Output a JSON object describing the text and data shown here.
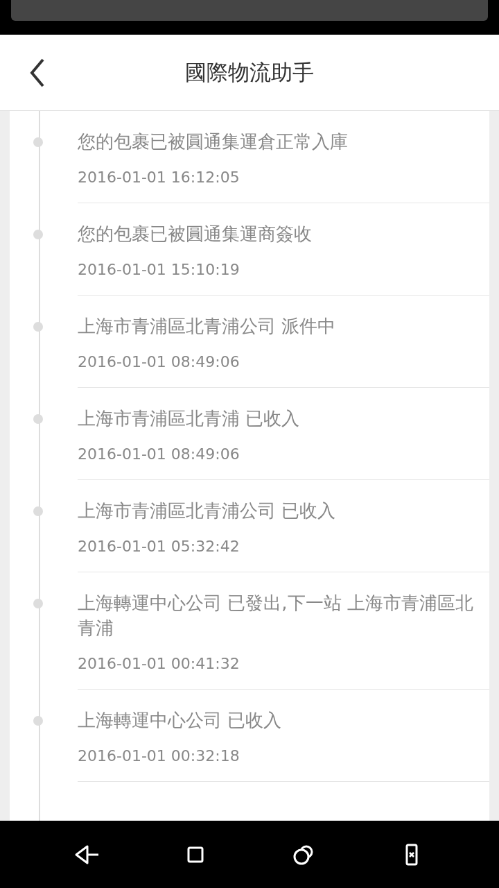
{
  "header": {
    "title": "國際物流助手"
  },
  "events": [
    {
      "text": "您的包裹已被圓通集運倉正常入庫",
      "time": "2016-01-01 16:12:05"
    },
    {
      "text": "您的包裹已被圓通集運商簽收",
      "time": "2016-01-01 15:10:19"
    },
    {
      "text": "上海市青浦區北青浦公司 派件中",
      "time": "2016-01-01 08:49:06"
    },
    {
      "text": "上海市青浦區北青浦 已收入",
      "time": "2016-01-01 08:49:06"
    },
    {
      "text": "上海市青浦區北青浦公司 已收入",
      "time": "2016-01-01 05:32:42"
    },
    {
      "text": "上海轉運中心公司 已發出,下一站 上海市青浦區北青浦",
      "time": "2016-01-01 00:41:32"
    },
    {
      "text": "上海轉運中心公司 已收入",
      "time": "2016-01-01 00:32:18"
    }
  ]
}
